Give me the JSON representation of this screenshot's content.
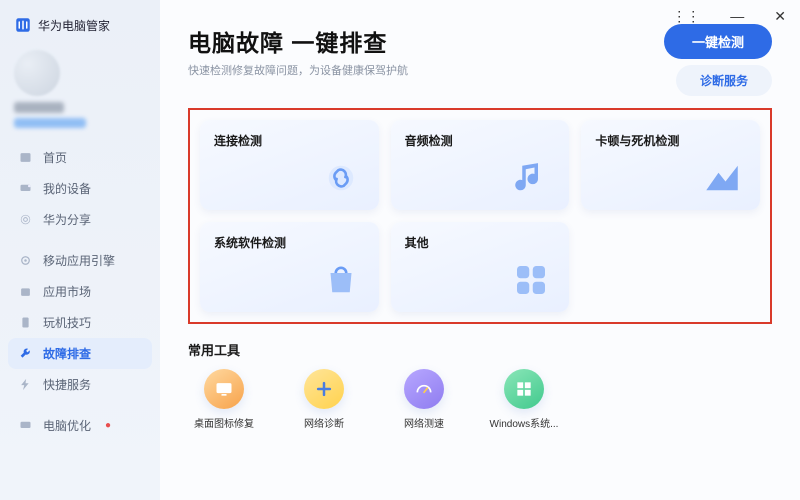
{
  "app": {
    "title": "华为电脑管家"
  },
  "sidebar": {
    "items": [
      {
        "label": "首页",
        "icon": "home"
      },
      {
        "label": "我的设备",
        "icon": "device"
      },
      {
        "label": "华为分享",
        "icon": "share"
      },
      {
        "label": "移动应用引擎",
        "icon": "mobile"
      },
      {
        "label": "应用市场",
        "icon": "store"
      },
      {
        "label": "玩机技巧",
        "icon": "tips"
      },
      {
        "label": "故障排查",
        "icon": "wrench",
        "active": true
      },
      {
        "label": "快捷服务",
        "icon": "bolt"
      },
      {
        "label": "电脑优化",
        "icon": "optimize",
        "dot": true
      }
    ]
  },
  "header": {
    "title": "电脑故障 一键排查",
    "subtitle": "快速检测修复故障问题，为设备健康保驾护航",
    "primary_btn": "一键检测",
    "secondary_btn": "诊断服务"
  },
  "cards": [
    {
      "title": "连接检测",
      "icon": "link"
    },
    {
      "title": "音频检测",
      "icon": "music"
    },
    {
      "title": "卡顿与死机检测",
      "icon": "chart"
    },
    {
      "title": "系统软件检测",
      "icon": "bag"
    },
    {
      "title": "其他",
      "icon": "grid"
    }
  ],
  "tools": {
    "header": "常用工具",
    "items": [
      {
        "label": "桌面图标修复",
        "icon": "desktop",
        "color": "#f7a24a"
      },
      {
        "label": "网络诊断",
        "icon": "plus",
        "color": "#ffd24c"
      },
      {
        "label": "网络测速",
        "icon": "gauge",
        "color": "#8f7cf0"
      },
      {
        "label": "Windows系统...",
        "icon": "windows",
        "color": "#41c98d"
      }
    ]
  }
}
